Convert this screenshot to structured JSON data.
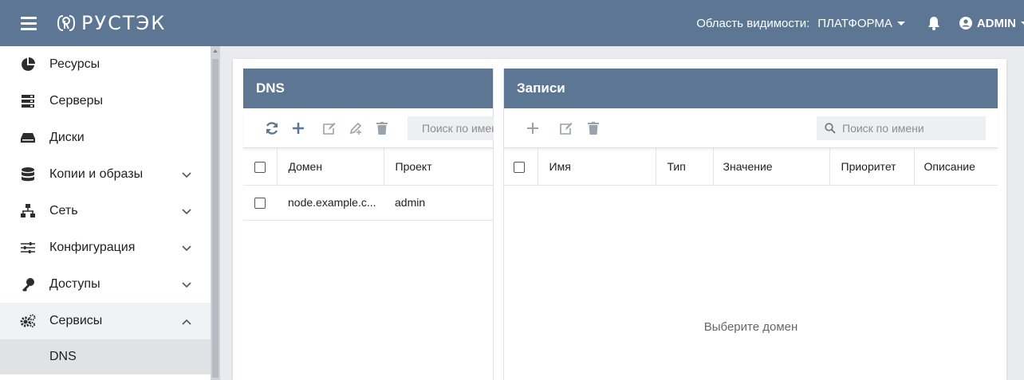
{
  "app": {
    "logo_text": "РУСТЭК"
  },
  "topbar": {
    "scope_label": "Область видимости:",
    "scope_value": "ПЛАТФОРМА",
    "user": "ADMIN"
  },
  "sidebar": {
    "items": [
      {
        "label": "Ресурсы",
        "icon": "pie-chart-icon"
      },
      {
        "label": "Серверы",
        "icon": "server-icon"
      },
      {
        "label": "Диски",
        "icon": "disk-icon"
      },
      {
        "label": "Копии и образы",
        "icon": "database-icon",
        "chevron": "down"
      },
      {
        "label": "Сеть",
        "icon": "network-icon",
        "chevron": "down"
      },
      {
        "label": "Конфигурация",
        "icon": "sliders-icon",
        "chevron": "down"
      },
      {
        "label": "Доступы",
        "icon": "key-icon",
        "chevron": "down"
      },
      {
        "label": "Сервисы",
        "icon": "cogs-icon",
        "chevron": "up"
      }
    ],
    "sub_item": "DNS"
  },
  "dns": {
    "title": "DNS",
    "search_placeholder": "Поиск по имени",
    "columns": [
      "Домен",
      "Проект"
    ],
    "rows": [
      {
        "domain": "node.example.c...",
        "project": "admin"
      }
    ]
  },
  "records": {
    "title": "Записи",
    "search_placeholder": "Поиск по имени",
    "columns": [
      "Имя",
      "Тип",
      "Значение",
      "Приоритет",
      "Описание"
    ],
    "empty_text": "Выберите домен"
  },
  "colors": {
    "header": "#5d7693",
    "accent": "#5d7693"
  }
}
